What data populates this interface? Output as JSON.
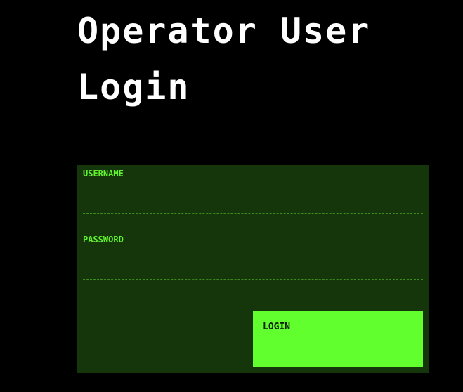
{
  "title": "Operator User Login",
  "form": {
    "username_label": "USERNAME",
    "username_value": "",
    "password_label": "PASSWORD",
    "password_value": "",
    "login_label": "LOGIN"
  },
  "colors": {
    "background": "#000000",
    "panel": "#14360a",
    "accent": "#62f42f",
    "button": "#62ff2f",
    "title": "#ffffff"
  }
}
